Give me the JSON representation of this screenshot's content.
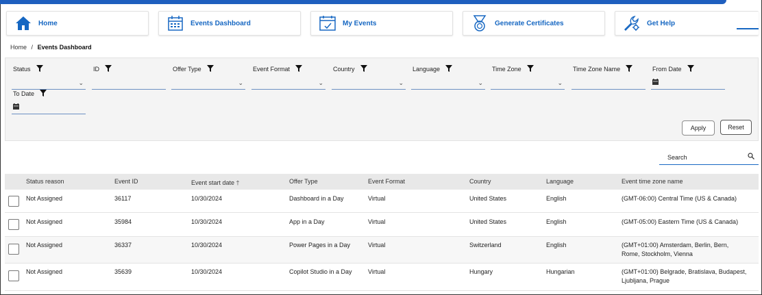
{
  "nav": {
    "tiles": [
      {
        "label": "Home",
        "icon": "home-icon"
      },
      {
        "label": "Events Dashboard",
        "icon": "calendar-icon"
      },
      {
        "label": "My Events",
        "icon": "calendar-check-icon"
      },
      {
        "label": "Generate Certificates",
        "icon": "medal-icon"
      },
      {
        "label": "Get Help",
        "icon": "wrench-gear-icon"
      }
    ]
  },
  "breadcrumb": {
    "home": "Home",
    "separator": "/",
    "current": "Events Dashboard"
  },
  "filters": {
    "items": [
      {
        "label": "Status",
        "kind": "select"
      },
      {
        "label": "ID",
        "kind": "text"
      },
      {
        "label": "Offer Type",
        "kind": "select"
      },
      {
        "label": "Event Format",
        "kind": "select"
      },
      {
        "label": "Country",
        "kind": "select"
      },
      {
        "label": "Language",
        "kind": "select"
      },
      {
        "label": "Time Zone",
        "kind": "select"
      },
      {
        "label": "Time Zone Name",
        "kind": "text"
      },
      {
        "label": "From Date",
        "kind": "date"
      },
      {
        "label": "To Date",
        "kind": "date"
      }
    ],
    "apply_label": "Apply",
    "reset_label": "Reset"
  },
  "search": {
    "placeholder": "Search"
  },
  "table": {
    "columns": [
      "Status reason",
      "Event ID",
      "Event start date",
      "Offer Type",
      "Event Format",
      "Country",
      "Language",
      "Event time zone name"
    ],
    "sort_indicator": "🡑",
    "rows": [
      {
        "status": "Not Assigned",
        "id": "36117",
        "date": "10/30/2024",
        "offer": "Dashboard in a Day",
        "format": "Virtual",
        "country": "United States",
        "language": "English",
        "tz": "(GMT-06:00) Central Time (US & Canada)"
      },
      {
        "status": "Not Assigned",
        "id": "35984",
        "date": "10/30/2024",
        "offer": "App in a Day",
        "format": "Virtual",
        "country": "United States",
        "language": "English",
        "tz": "(GMT-05:00) Eastern Time (US & Canada)"
      },
      {
        "status": "Not Assigned",
        "id": "36337",
        "date": "10/30/2024",
        "offer": "Power Pages in a Day",
        "format": "Virtual",
        "country": "Switzerland",
        "language": "English",
        "tz": "(GMT+01:00) Amsterdam, Berlin, Bern, Rome, Stockholm, Vienna"
      },
      {
        "status": "Not Assigned",
        "id": "35639",
        "date": "10/30/2024",
        "offer": "Copilot Studio in a Day",
        "format": "Virtual",
        "country": "Hungary",
        "language": "Hungarian",
        "tz": "(GMT+01:00) Belgrade, Bratislava, Budapest, Ljubljana, Prague"
      }
    ]
  },
  "colors": {
    "accent": "#1667c2",
    "topbar": "#1f5fbf",
    "panel": "#f4f4f4",
    "header": "#e8e8e8"
  }
}
